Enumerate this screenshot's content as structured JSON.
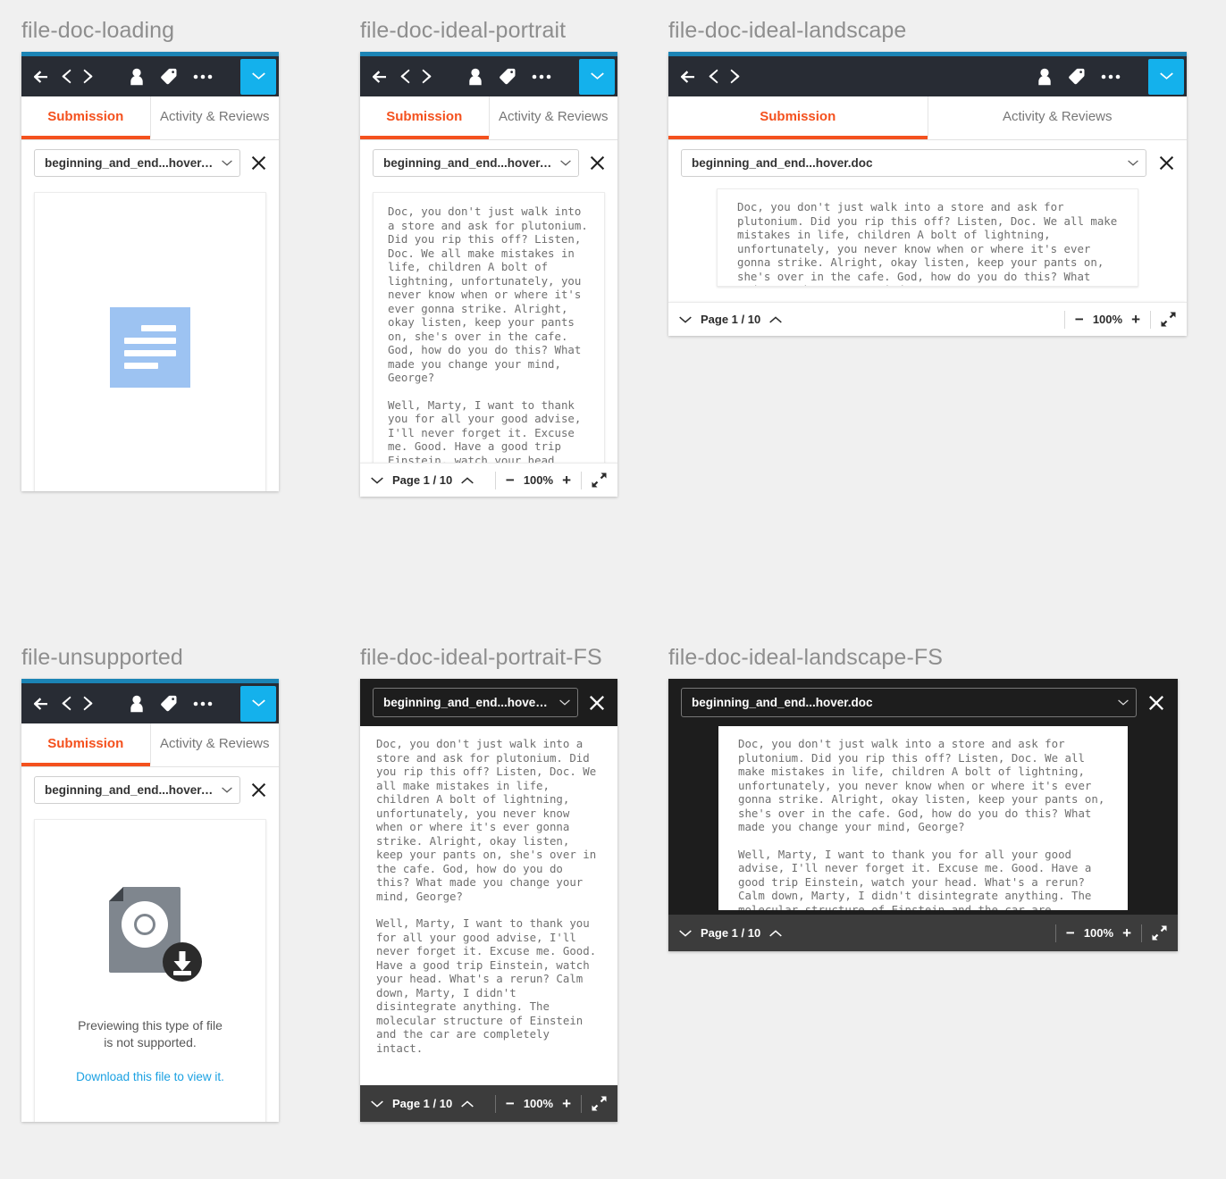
{
  "panels": [
    {
      "title": "file-doc-loading"
    },
    {
      "title": "file-doc-ideal-portrait"
    },
    {
      "title": "file-doc-ideal-landscape"
    },
    {
      "title": "file-unsupported"
    },
    {
      "title": "file-doc-ideal-portrait-FS"
    },
    {
      "title": "file-doc-ideal-landscape-FS"
    }
  ],
  "toolbar": {
    "back_label": "back-arrow",
    "prev_label": "chevron-left",
    "next_label": "chevron-right",
    "user_label": "user-icon",
    "tag_label": "tag-icon",
    "more_label": "ellipsis-icon",
    "dropdown_label": "chevron-down"
  },
  "tabs": {
    "submission": "Submission",
    "activity": "Activity & Reviews"
  },
  "filebar": {
    "filename": "beginning_and_end...hover.doc",
    "close_label": "✕"
  },
  "pagebar": {
    "page_label": "Page 1 / 10",
    "zoom_label": "100%",
    "minus": "−",
    "plus": "+"
  },
  "unsupported": {
    "message_line1": "Previewing this type of file",
    "message_line2": "is not supported.",
    "link": "Download this file to view it."
  },
  "document": {
    "paragraph1": "Doc, you don't just walk into a store and ask for plutonium. Did you rip this off? Listen, Doc. We all make mistakes in life, children A bolt of lightning, unfortunately, you never know when or where it's ever gonna strike. Alright, okay listen, keep your pants on, she's over in the cafe. God, how do you do this? What made you change your mind, George?",
    "paragraph2": "Well, Marty, I want to thank you for all your good advise, I'll never forget it. Excuse me. Good. Have a good trip Einstein, watch your head. What's a rerun? Calm down, Marty, I didn't disintegrate anything. The molecular structure of Einstein and the car are completely intact."
  },
  "colors": {
    "accent_orange": "#f4511e",
    "accent_blue": "#14b1ec",
    "strip_blue": "#1b84b5",
    "toolbar_dark": "#282c34",
    "link_blue": "#1ba1e2",
    "placeholder_blue": "#9dc3f2"
  }
}
